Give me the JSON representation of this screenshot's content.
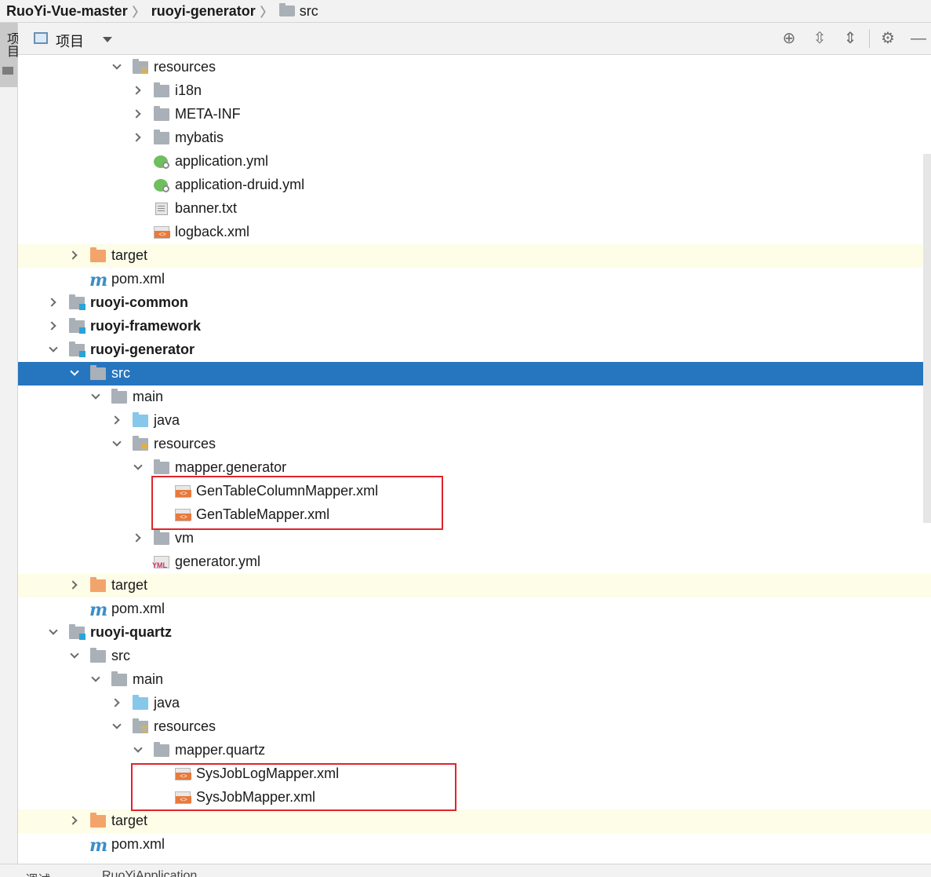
{
  "breadcrumb": [
    {
      "label": "RuoYi-Vue-master"
    },
    {
      "label": "ruoyi-generator"
    },
    {
      "label": "src"
    }
  ],
  "sidebar": {
    "tab_label": "项目"
  },
  "toolbar": {
    "view_label": "项目"
  },
  "tree": [
    {
      "label": "resources",
      "icon": "resources-folder-icon",
      "arrow": "expanded"
    },
    {
      "label": "i18n",
      "icon": "folder-icon",
      "arrow": "collapsed"
    },
    {
      "label": "META-INF",
      "icon": "folder-icon",
      "arrow": "collapsed"
    },
    {
      "label": "mybatis",
      "icon": "folder-icon",
      "arrow": "collapsed"
    },
    {
      "label": "application.yml",
      "icon": "spring-yml-icon",
      "arrow": "none"
    },
    {
      "label": "application-druid.yml",
      "icon": "spring-yml-icon",
      "arrow": "none"
    },
    {
      "label": "banner.txt",
      "icon": "text-file-icon",
      "arrow": "none"
    },
    {
      "label": "logback.xml",
      "icon": "xml-file-icon",
      "arrow": "none"
    },
    {
      "label": "target",
      "icon": "excluded-folder-icon",
      "arrow": "collapsed"
    },
    {
      "label": "pom.xml",
      "icon": "maven-icon",
      "arrow": "none"
    },
    {
      "label": "ruoyi-common",
      "icon": "module-folder-icon",
      "arrow": "collapsed"
    },
    {
      "label": "ruoyi-framework",
      "icon": "module-folder-icon",
      "arrow": "collapsed"
    },
    {
      "label": "ruoyi-generator",
      "icon": "module-folder-icon",
      "arrow": "expanded"
    },
    {
      "label": "src",
      "icon": "folder-icon",
      "arrow": "expanded"
    },
    {
      "label": "main",
      "icon": "folder-icon",
      "arrow": "expanded"
    },
    {
      "label": "java",
      "icon": "source-folder-icon",
      "arrow": "collapsed"
    },
    {
      "label": "resources",
      "icon": "resources-folder-icon",
      "arrow": "expanded"
    },
    {
      "label": "mapper.generator",
      "icon": "folder-icon",
      "arrow": "expanded"
    },
    {
      "label": "GenTableColumnMapper.xml",
      "icon": "xml-file-icon",
      "arrow": "none"
    },
    {
      "label": "GenTableMapper.xml",
      "icon": "xml-file-icon",
      "arrow": "none"
    },
    {
      "label": "vm",
      "icon": "folder-icon",
      "arrow": "collapsed"
    },
    {
      "label": "generator.yml",
      "icon": "yml-file-icon",
      "arrow": "none"
    },
    {
      "label": "target",
      "icon": "excluded-folder-icon",
      "arrow": "collapsed"
    },
    {
      "label": "pom.xml",
      "icon": "maven-icon",
      "arrow": "none"
    },
    {
      "label": "ruoyi-quartz",
      "icon": "module-folder-icon",
      "arrow": "expanded"
    },
    {
      "label": "src",
      "icon": "folder-icon",
      "arrow": "expanded"
    },
    {
      "label": "main",
      "icon": "folder-icon",
      "arrow": "expanded"
    },
    {
      "label": "java",
      "icon": "source-folder-icon",
      "arrow": "collapsed"
    },
    {
      "label": "resources",
      "icon": "resources-folder-icon",
      "arrow": "expanded"
    },
    {
      "label": "mapper.quartz",
      "icon": "folder-icon",
      "arrow": "expanded"
    },
    {
      "label": "SysJobLogMapper.xml",
      "icon": "xml-file-icon",
      "arrow": "none"
    },
    {
      "label": "SysJobMapper.xml",
      "icon": "xml-file-icon",
      "arrow": "none"
    },
    {
      "label": "target",
      "icon": "excluded-folder-icon",
      "arrow": "collapsed"
    },
    {
      "label": "pom.xml",
      "icon": "maven-icon",
      "arrow": "none"
    }
  ],
  "status": {
    "left": "调试",
    "right": "RuoYiApplication"
  },
  "colors": {
    "selection": "#2675bf",
    "highlight_row": "#fdfde8",
    "annotation_box": "#e0242b"
  }
}
